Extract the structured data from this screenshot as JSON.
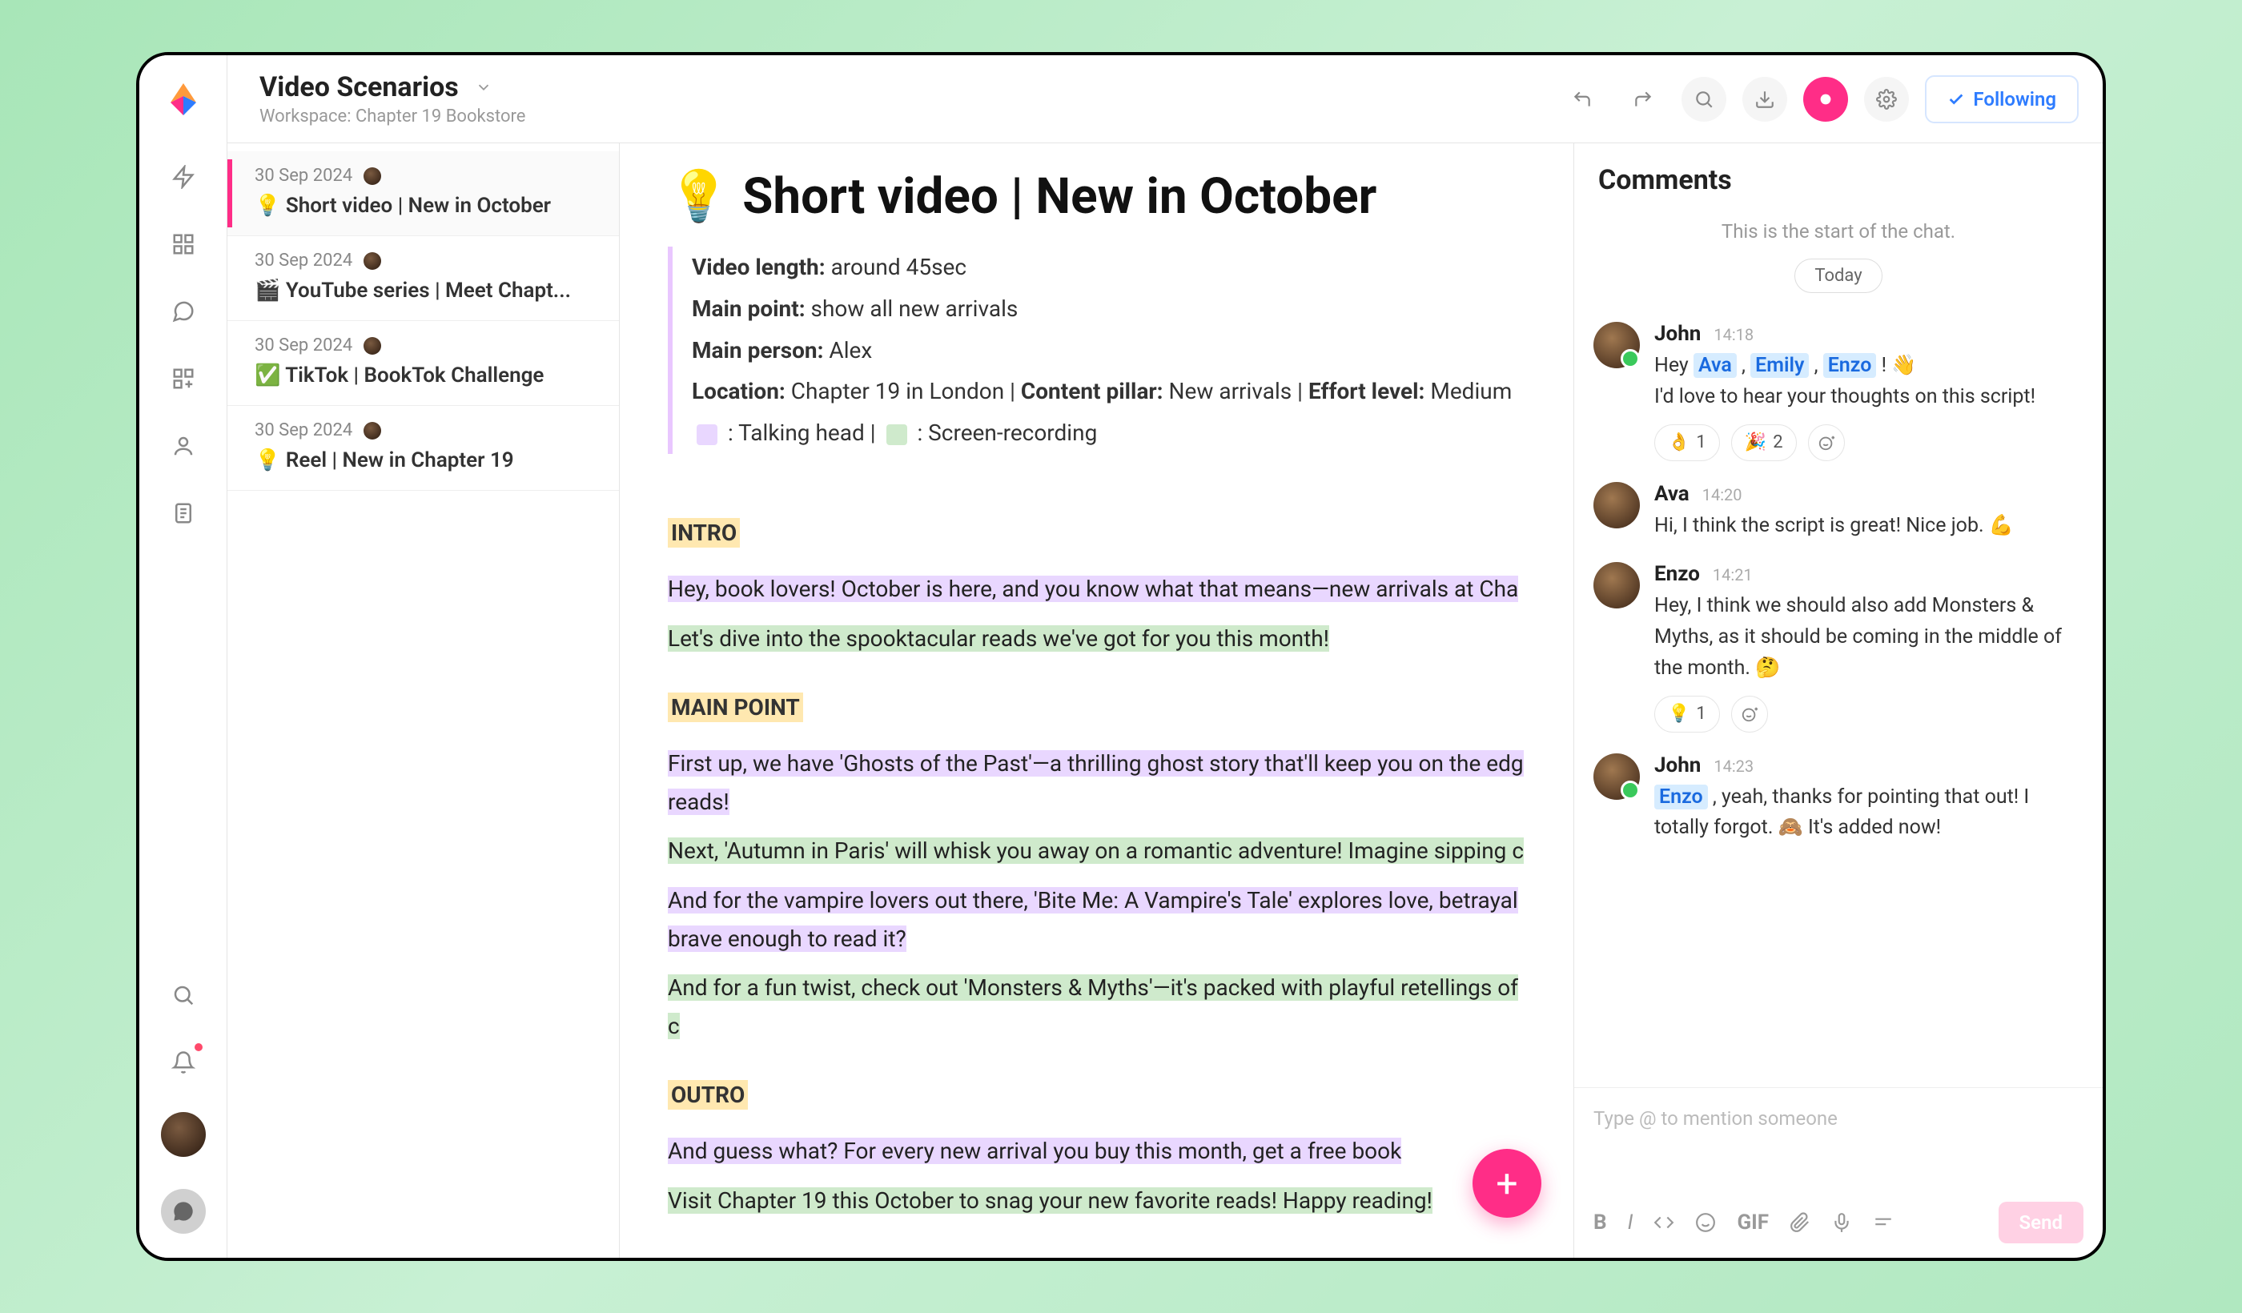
{
  "header": {
    "title": "Video Scenarios",
    "workspace_label": "Workspace: Chapter 19 Bookstore",
    "following_label": "Following"
  },
  "sidebar_docs": [
    {
      "date": "30 Sep 2024",
      "title": "💡 Short video | New in October",
      "active": true
    },
    {
      "date": "30 Sep 2024",
      "title": "🎬 YouTube series | Meet Chapt..."
    },
    {
      "date": "30 Sep 2024",
      "title": "✅ TikTok | BookTok Challenge"
    },
    {
      "date": "30 Sep 2024",
      "title": "💡 Reel | New in Chapter 19"
    }
  ],
  "document": {
    "title_emoji": "💡",
    "title": "Short video | New in October",
    "meta": {
      "video_length_label": "Video length:",
      "video_length": "around 45sec",
      "main_point_label": "Main point:",
      "main_point": "show all new arrivals",
      "main_person_label": "Main person:",
      "main_person": "Alex",
      "location_label": "Location:",
      "location": "Chapter 19 in London",
      "content_pillar_label": "Content pillar:",
      "content_pillar": "New arrivals",
      "effort_label": "Effort level:",
      "effort": "Medium",
      "legend_talking": ": Talking head |",
      "legend_screen": ": Screen-recording"
    },
    "sections": {
      "intro_label": "INTRO",
      "intro_lines": [
        {
          "text": "Hey, book lovers! October is here, and you know what that means—new arrivals at Cha",
          "cls": "hl-purple"
        },
        {
          "text": "Let's dive into the spooktacular reads we've got for you this month!",
          "cls": "hl-green"
        }
      ],
      "main_label": "MAIN POINT",
      "main_lines": [
        {
          "text": "First up, we have 'Ghosts of the Past'—a thrilling ghost story that'll keep you on the edg",
          "cls": "hl-purple"
        },
        {
          "text": "reads!",
          "cls": "hl-purple",
          "cont": true
        },
        {
          "text": "Next, 'Autumn in Paris' will whisk you away on a romantic adventure! Imagine sipping c",
          "cls": "hl-green"
        },
        {
          "text": "And for the vampire lovers out there, 'Bite Me: A Vampire's Tale' explores love, betrayal",
          "cls": "hl-purple"
        },
        {
          "text": "brave enough to read it?",
          "cls": "hl-purple",
          "cont": true
        },
        {
          "text": "And for a fun twist, check out 'Monsters & Myths'—it's packed with playful retellings of c",
          "cls": "hl-green"
        }
      ],
      "outro_label": "OUTRO",
      "outro_lines": [
        {
          "text": "And guess what? For every new arrival you buy this month, get a free book",
          "cls": "hl-purple"
        },
        {
          "text": "Visit Chapter 19 this October to snag your new favorite reads! Happy reading!",
          "cls": "hl-green"
        }
      ]
    }
  },
  "comments": {
    "title": "Comments",
    "start_text": "This is the start of the chat.",
    "day": "Today",
    "messages": [
      {
        "author": "John",
        "time": "14:18",
        "online": true,
        "body_parts": [
          {
            "t": "Hey "
          },
          {
            "m": "Ava"
          },
          {
            "t": " , "
          },
          {
            "m": "Emily"
          },
          {
            "t": " , "
          },
          {
            "m": "Enzo"
          },
          {
            "t": " ! 👋"
          },
          {
            "br": true
          },
          {
            "t": "I'd love to hear your thoughts on this script!"
          }
        ],
        "reactions": [
          {
            "e": "👌",
            "c": "1"
          },
          {
            "e": "🎉",
            "c": "2"
          }
        ],
        "add_react": true
      },
      {
        "author": "Ava",
        "time": "14:20",
        "body_parts": [
          {
            "t": "Hi, I think the script is great! Nice job. 💪"
          }
        ]
      },
      {
        "author": "Enzo",
        "time": "14:21",
        "body_parts": [
          {
            "t": "Hey, I think we should also add Monsters & Myths, as it should be coming in the middle of the month. 🤔"
          }
        ],
        "reactions": [
          {
            "e": "💡",
            "c": "1"
          }
        ],
        "add_react": true
      },
      {
        "author": "John",
        "time": "14:23",
        "online": true,
        "body_parts": [
          {
            "m": "Enzo"
          },
          {
            "t": " , yeah, thanks for pointing that out! I totally forgot. 🙈 It's added now!"
          }
        ]
      }
    ],
    "composer": {
      "placeholder": "Type @ to mention someone",
      "send_label": "Send",
      "gif_label": "GIF"
    }
  }
}
